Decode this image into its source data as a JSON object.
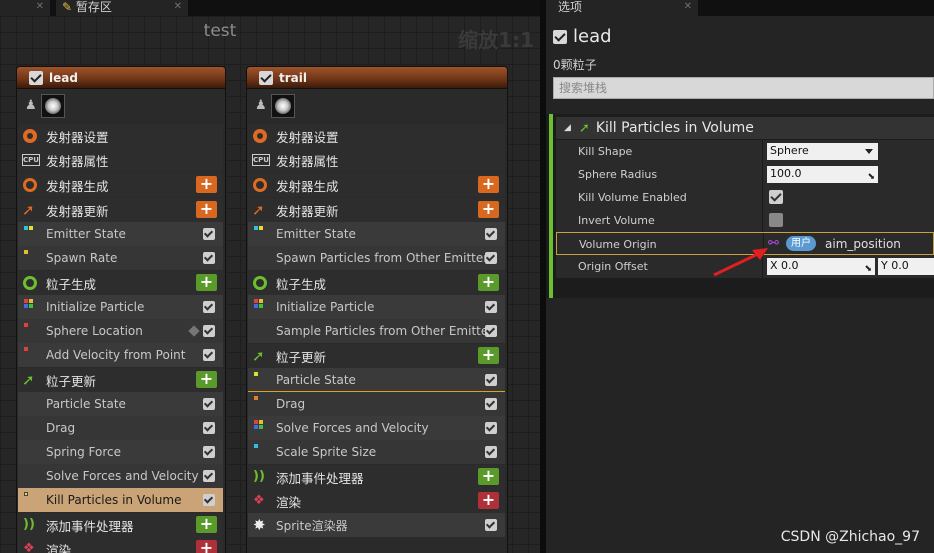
{
  "tabs": {
    "left_tab": "暂存区",
    "right_tab": "选项"
  },
  "graph": {
    "title": "test",
    "zoom": "缩放1:1"
  },
  "lead": {
    "name": "lead",
    "rows": [
      {
        "label": "发射器设置"
      },
      {
        "label": "发射器属性"
      },
      {
        "label": "发射器生成"
      },
      {
        "label": "发射器更新"
      },
      {
        "label": "Emitter State"
      },
      {
        "label": "Spawn Rate"
      },
      {
        "label": "粒子生成"
      },
      {
        "label": "Initialize Particle"
      },
      {
        "label": "Sphere Location"
      },
      {
        "label": "Add Velocity from Point"
      },
      {
        "label": "粒子更新"
      },
      {
        "label": "Particle State"
      },
      {
        "label": "Drag"
      },
      {
        "label": "Spring Force"
      },
      {
        "label": "Solve Forces and Velocity"
      },
      {
        "label": "Kill Particles in Volume"
      },
      {
        "label": "添加事件处理器"
      },
      {
        "label": "渲染"
      }
    ]
  },
  "trail": {
    "name": "trail",
    "rows": [
      {
        "label": "发射器设置"
      },
      {
        "label": "发射器属性"
      },
      {
        "label": "发射器生成"
      },
      {
        "label": "发射器更新"
      },
      {
        "label": "Emitter State"
      },
      {
        "label": "Spawn Particles from Other Emitter"
      },
      {
        "label": "粒子生成"
      },
      {
        "label": "Initialize Particle"
      },
      {
        "label": "Sample Particles from Other Emitter"
      },
      {
        "label": "粒子更新"
      },
      {
        "label": "Particle State"
      },
      {
        "label": "Drag"
      },
      {
        "label": "Solve Forces and Velocity"
      },
      {
        "label": "Scale Sprite Size"
      },
      {
        "label": "添加事件处理器"
      },
      {
        "label": "渲染"
      },
      {
        "label": "Sprite渲染器"
      }
    ]
  },
  "panel": {
    "title": "lead",
    "count": "0颗粒子",
    "search_placeholder": "搜索堆栈",
    "module_title": "Kill Particles in Volume",
    "props": {
      "kill_shape_label": "Kill Shape",
      "kill_shape_value": "Sphere",
      "sphere_radius_label": "Sphere Radius",
      "sphere_radius_value": "100.0",
      "kill_volume_enabled_label": "Kill Volume Enabled",
      "invert_volume_label": "Invert Volume",
      "volume_origin_label": "Volume Origin",
      "volume_origin_tag": "用户",
      "volume_origin_param": "aim_position",
      "origin_offset_label": "Origin Offset",
      "origin_offset_x": "X 0.0",
      "origin_offset_y": "Y 0.0"
    }
  },
  "watermark": "CSDN @Zhichao_97",
  "colors": {
    "accent_green": "#6cc030",
    "accent_orange": "#e06a22",
    "highlight_row": "#caa476",
    "selection_border": "#e0a020",
    "annotation_red": "#e02020"
  }
}
